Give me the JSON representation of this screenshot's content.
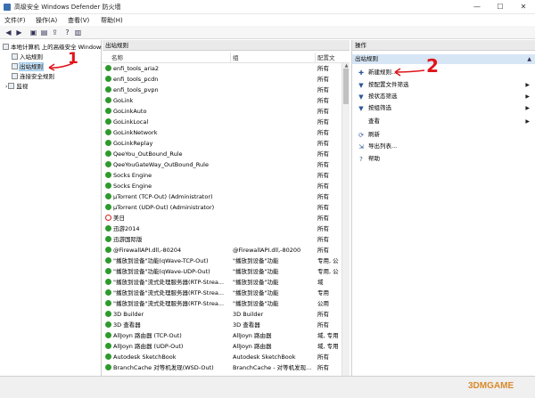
{
  "window": {
    "title": "高级安全 Windows Defender 防火墙",
    "minimize_label": "—",
    "maximize_label": "☐",
    "close_label": "✕"
  },
  "menu": {
    "items": [
      "文件(F)",
      "操作(A)",
      "查看(V)",
      "帮助(H)"
    ]
  },
  "toolbar": {
    "back_label": "◀",
    "forward_label": "▶",
    "up_label": "▣",
    "icon2_label": "▤",
    "icon3_label": "⇪",
    "help_label": "?",
    "icon4_label": "▥"
  },
  "tree": {
    "root": "本地计算机 上的高级安全 Windows Defender 防火墙",
    "items": [
      {
        "label": "入站规则"
      },
      {
        "label": "出站规则"
      },
      {
        "label": "连接安全规则"
      },
      {
        "label": "监视"
      }
    ]
  },
  "center": {
    "header": "出站规则",
    "columns": [
      "名称",
      "组",
      "配置文"
    ],
    "rows": [
      {
        "name": "enfi_tools_aria2",
        "group": "",
        "profile": "所有",
        "status": "allow"
      },
      {
        "name": "enfi_tools_pcdn",
        "group": "",
        "profile": "所有",
        "status": "allow"
      },
      {
        "name": "enfi_tools_pvpn",
        "group": "",
        "profile": "所有",
        "status": "allow"
      },
      {
        "name": "GoLink",
        "group": "",
        "profile": "所有",
        "status": "allow"
      },
      {
        "name": "GoLinkAuto",
        "group": "",
        "profile": "所有",
        "status": "allow"
      },
      {
        "name": "GoLinkLocal",
        "group": "",
        "profile": "所有",
        "status": "allow"
      },
      {
        "name": "GoLinkNetwork",
        "group": "",
        "profile": "所有",
        "status": "allow"
      },
      {
        "name": "GoLinkReplay",
        "group": "",
        "profile": "所有",
        "status": "allow"
      },
      {
        "name": "QeeYou_OutBound_Rule",
        "group": "",
        "profile": "所有",
        "status": "allow"
      },
      {
        "name": "QeeYouGateWay_OutBound_Rule",
        "group": "",
        "profile": "所有",
        "status": "allow"
      },
      {
        "name": "Socks Engine",
        "group": "",
        "profile": "所有",
        "status": "allow"
      },
      {
        "name": "Socks Engine",
        "group": "",
        "profile": "所有",
        "status": "allow"
      },
      {
        "name": "μTorrent (TCP-Out) (Administrator)",
        "group": "",
        "profile": "所有",
        "status": "allow"
      },
      {
        "name": "μTorrent (UDP-Out) (Administrator)",
        "group": "",
        "profile": "所有",
        "status": "allow"
      },
      {
        "name": "美日",
        "group": "",
        "profile": "所有",
        "status": "blocked"
      },
      {
        "name": "迅游2014",
        "group": "",
        "profile": "所有",
        "status": "allow"
      },
      {
        "name": "迅游国际版",
        "group": "",
        "profile": "所有",
        "status": "allow"
      },
      {
        "name": "@FirewallAPI.dll,-80204",
        "group": "@FirewallAPI.dll,-80200",
        "profile": "所有",
        "status": "allow"
      },
      {
        "name": "\"播放到设备\"功能(qWave-TCP-Out)",
        "group": "\"播放到设备\"功能",
        "profile": "专用, 公",
        "status": "allow"
      },
      {
        "name": "\"播放到设备\"功能(qWave-UDP-Out)",
        "group": "\"播放到设备\"功能",
        "profile": "专用, 公",
        "status": "allow"
      },
      {
        "name": "\"播放到设备\"流式处理服务器(RTP-Strea...",
        "group": "\"播放到设备\"功能",
        "profile": "域",
        "status": "allow"
      },
      {
        "name": "\"播放到设备\"流式处理服务器(RTP-Strea...",
        "group": "\"播放到设备\"功能",
        "profile": "专用",
        "status": "allow"
      },
      {
        "name": "\"播放到设备\"流式处理服务器(RTP-Strea...",
        "group": "\"播放到设备\"功能",
        "profile": "公用",
        "status": "allow"
      },
      {
        "name": "3D Builder",
        "group": "3D Builder",
        "profile": "所有",
        "status": "allow"
      },
      {
        "name": "3D 查看器",
        "group": "3D 查看器",
        "profile": "所有",
        "status": "allow"
      },
      {
        "name": "AllJoyn 路由器 (TCP-Out)",
        "group": "AllJoyn 路由器",
        "profile": "域, 专用",
        "status": "allow"
      },
      {
        "name": "AllJoyn 路由器 (UDP-Out)",
        "group": "AllJoyn 路由器",
        "profile": "域, 专用",
        "status": "allow"
      },
      {
        "name": "Autodesk SketchBook",
        "group": "Autodesk SketchBook",
        "profile": "所有",
        "status": "allow"
      },
      {
        "name": "BranchCache 对等机发现(WSD-Out)",
        "group": "BranchCache - 对等机发现...",
        "profile": "所有",
        "status": "allow"
      }
    ]
  },
  "actions": {
    "header": "操作",
    "section": "出站规则",
    "section_arrow": "▲",
    "items": [
      {
        "label": "新建规则...",
        "icon": "new-rule-icon",
        "glyph": "✚",
        "more": ""
      },
      {
        "label": "按配置文件筛选",
        "icon": "filter-icon",
        "glyph": "▼",
        "more": "▶"
      },
      {
        "label": "按状态筛选",
        "icon": "filter-icon",
        "glyph": "▼",
        "more": "▶"
      },
      {
        "label": "按组筛选",
        "icon": "filter-icon",
        "glyph": "▼",
        "more": "▶"
      },
      {
        "label": "查看",
        "icon": "view-icon",
        "glyph": "",
        "more": "▶"
      },
      {
        "label": "刷新",
        "icon": "refresh-icon",
        "glyph": "⟳",
        "more": ""
      },
      {
        "label": "导出列表...",
        "icon": "export-icon",
        "glyph": "⇲",
        "more": ""
      },
      {
        "label": "帮助",
        "icon": "help-icon",
        "glyph": "?",
        "more": ""
      }
    ]
  },
  "annotations": {
    "one": "1",
    "two": "2"
  },
  "watermark": "3DMGAME",
  "colors": {
    "allow": "#2e9a2e",
    "blocked": "#cc2222",
    "annotation": "#e0141a",
    "selection": "#cce4f7",
    "section": "#d7e6f5"
  }
}
